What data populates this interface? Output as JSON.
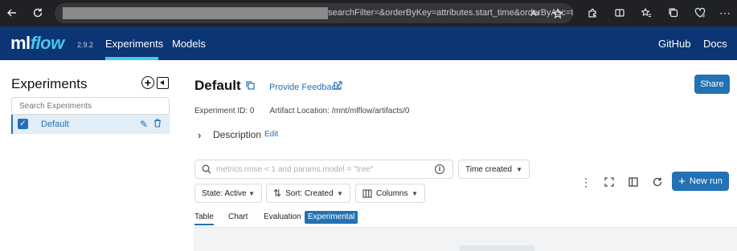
{
  "browser": {
    "url_tail": "searchFilter=&orderByKey=attributes.start_time&orderByAsc=fals..."
  },
  "header": {
    "logo_ml": "ml",
    "logo_flow": "flow",
    "version": "2.9.2",
    "nav": [
      "Experiments",
      "Models"
    ],
    "right_nav": [
      "GitHub",
      "Docs"
    ],
    "active_nav": "Experiments",
    "bg_color": "#0b3574",
    "accent_color": "#43c9ed"
  },
  "sidebar": {
    "title": "Experiments",
    "search_placeholder": "Search Experiments",
    "experiments": [
      {
        "name": "Default",
        "checked": true
      }
    ]
  },
  "main": {
    "title": "Default",
    "feedback_link": "Provide Feedback",
    "share_label": "Share",
    "experiment_id": "Experiment ID: 0",
    "artifact_location": "Artifact Location: /mnt/mlflow/artifacts/0",
    "description_label": "Description",
    "description_edit": "Edit",
    "search_placeholder": "metrics.rmse < 1 and params.model = \"tree\"",
    "time_select": "Time created",
    "state_select": "State: Active",
    "sort_select": "Sort: Created",
    "columns_label": "Columns",
    "new_run_label": "New run",
    "view_tabs": [
      "Table",
      "Chart",
      "Evaluation"
    ],
    "experimental_badge": "Experimental",
    "primary_color": "#2272b4"
  }
}
